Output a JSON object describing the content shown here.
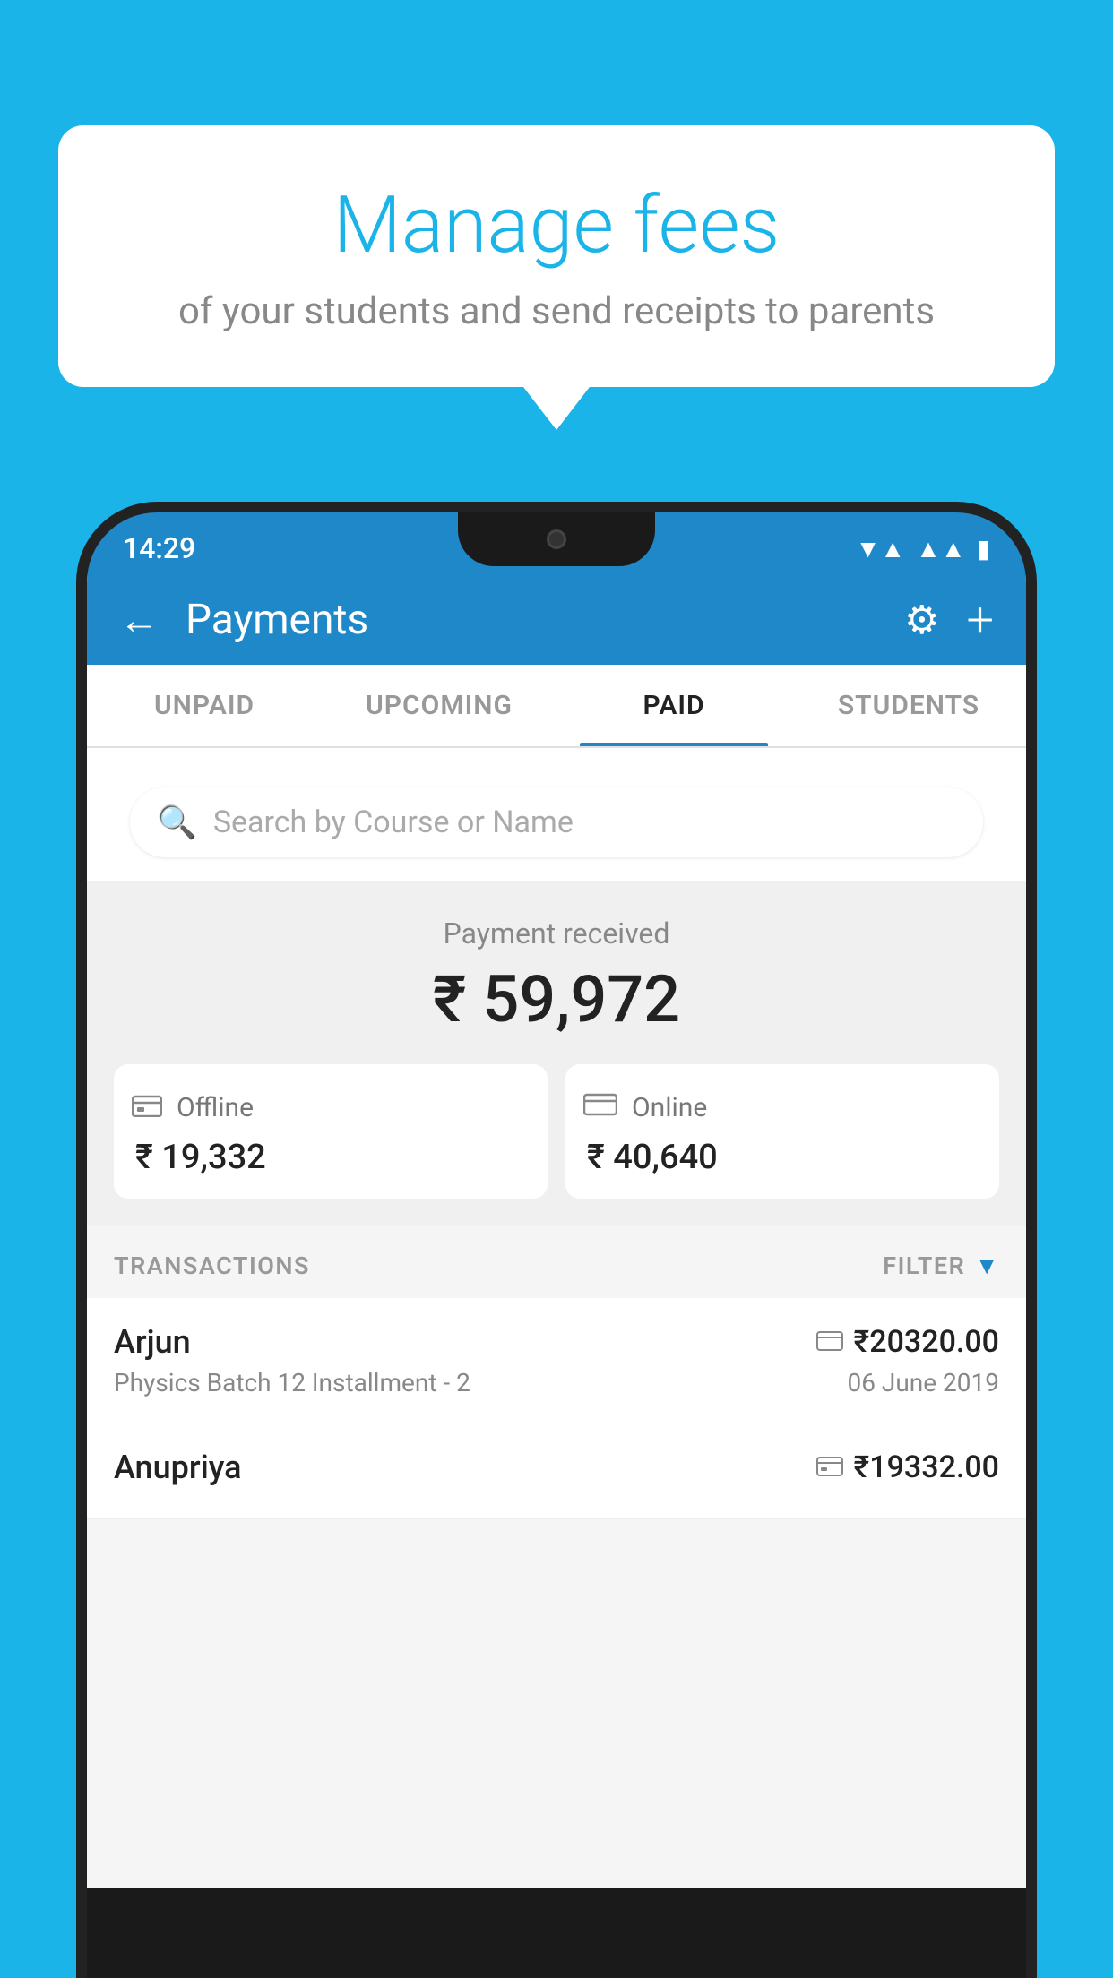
{
  "background_color": "#1ab4e8",
  "speech_bubble": {
    "title": "Manage fees",
    "subtitle": "of your students and send receipts to parents"
  },
  "status_bar": {
    "time": "14:29",
    "icons": [
      "wifi",
      "signal",
      "battery"
    ]
  },
  "app_header": {
    "title": "Payments",
    "back_label": "←",
    "gear_label": "⚙",
    "plus_label": "+"
  },
  "tabs": [
    {
      "label": "UNPAID",
      "active": false
    },
    {
      "label": "UPCOMING",
      "active": false
    },
    {
      "label": "PAID",
      "active": true
    },
    {
      "label": "STUDENTS",
      "active": false
    }
  ],
  "search": {
    "placeholder": "Search by Course or Name"
  },
  "payment_received": {
    "label": "Payment received",
    "amount": "₹ 59,972",
    "cards": [
      {
        "type": "Offline",
        "amount": "₹ 19,332",
        "icon": "offline"
      },
      {
        "type": "Online",
        "amount": "₹ 40,640",
        "icon": "online"
      }
    ]
  },
  "transactions": {
    "header": "TRANSACTIONS",
    "filter_label": "FILTER",
    "rows": [
      {
        "name": "Arjun",
        "course": "Physics Batch 12 Installment - 2",
        "amount": "₹20320.00",
        "date": "06 June 2019",
        "payment_type": "online"
      },
      {
        "name": "Anupriya",
        "course": "",
        "amount": "₹19332.00",
        "date": "",
        "payment_type": "offline"
      }
    ]
  }
}
